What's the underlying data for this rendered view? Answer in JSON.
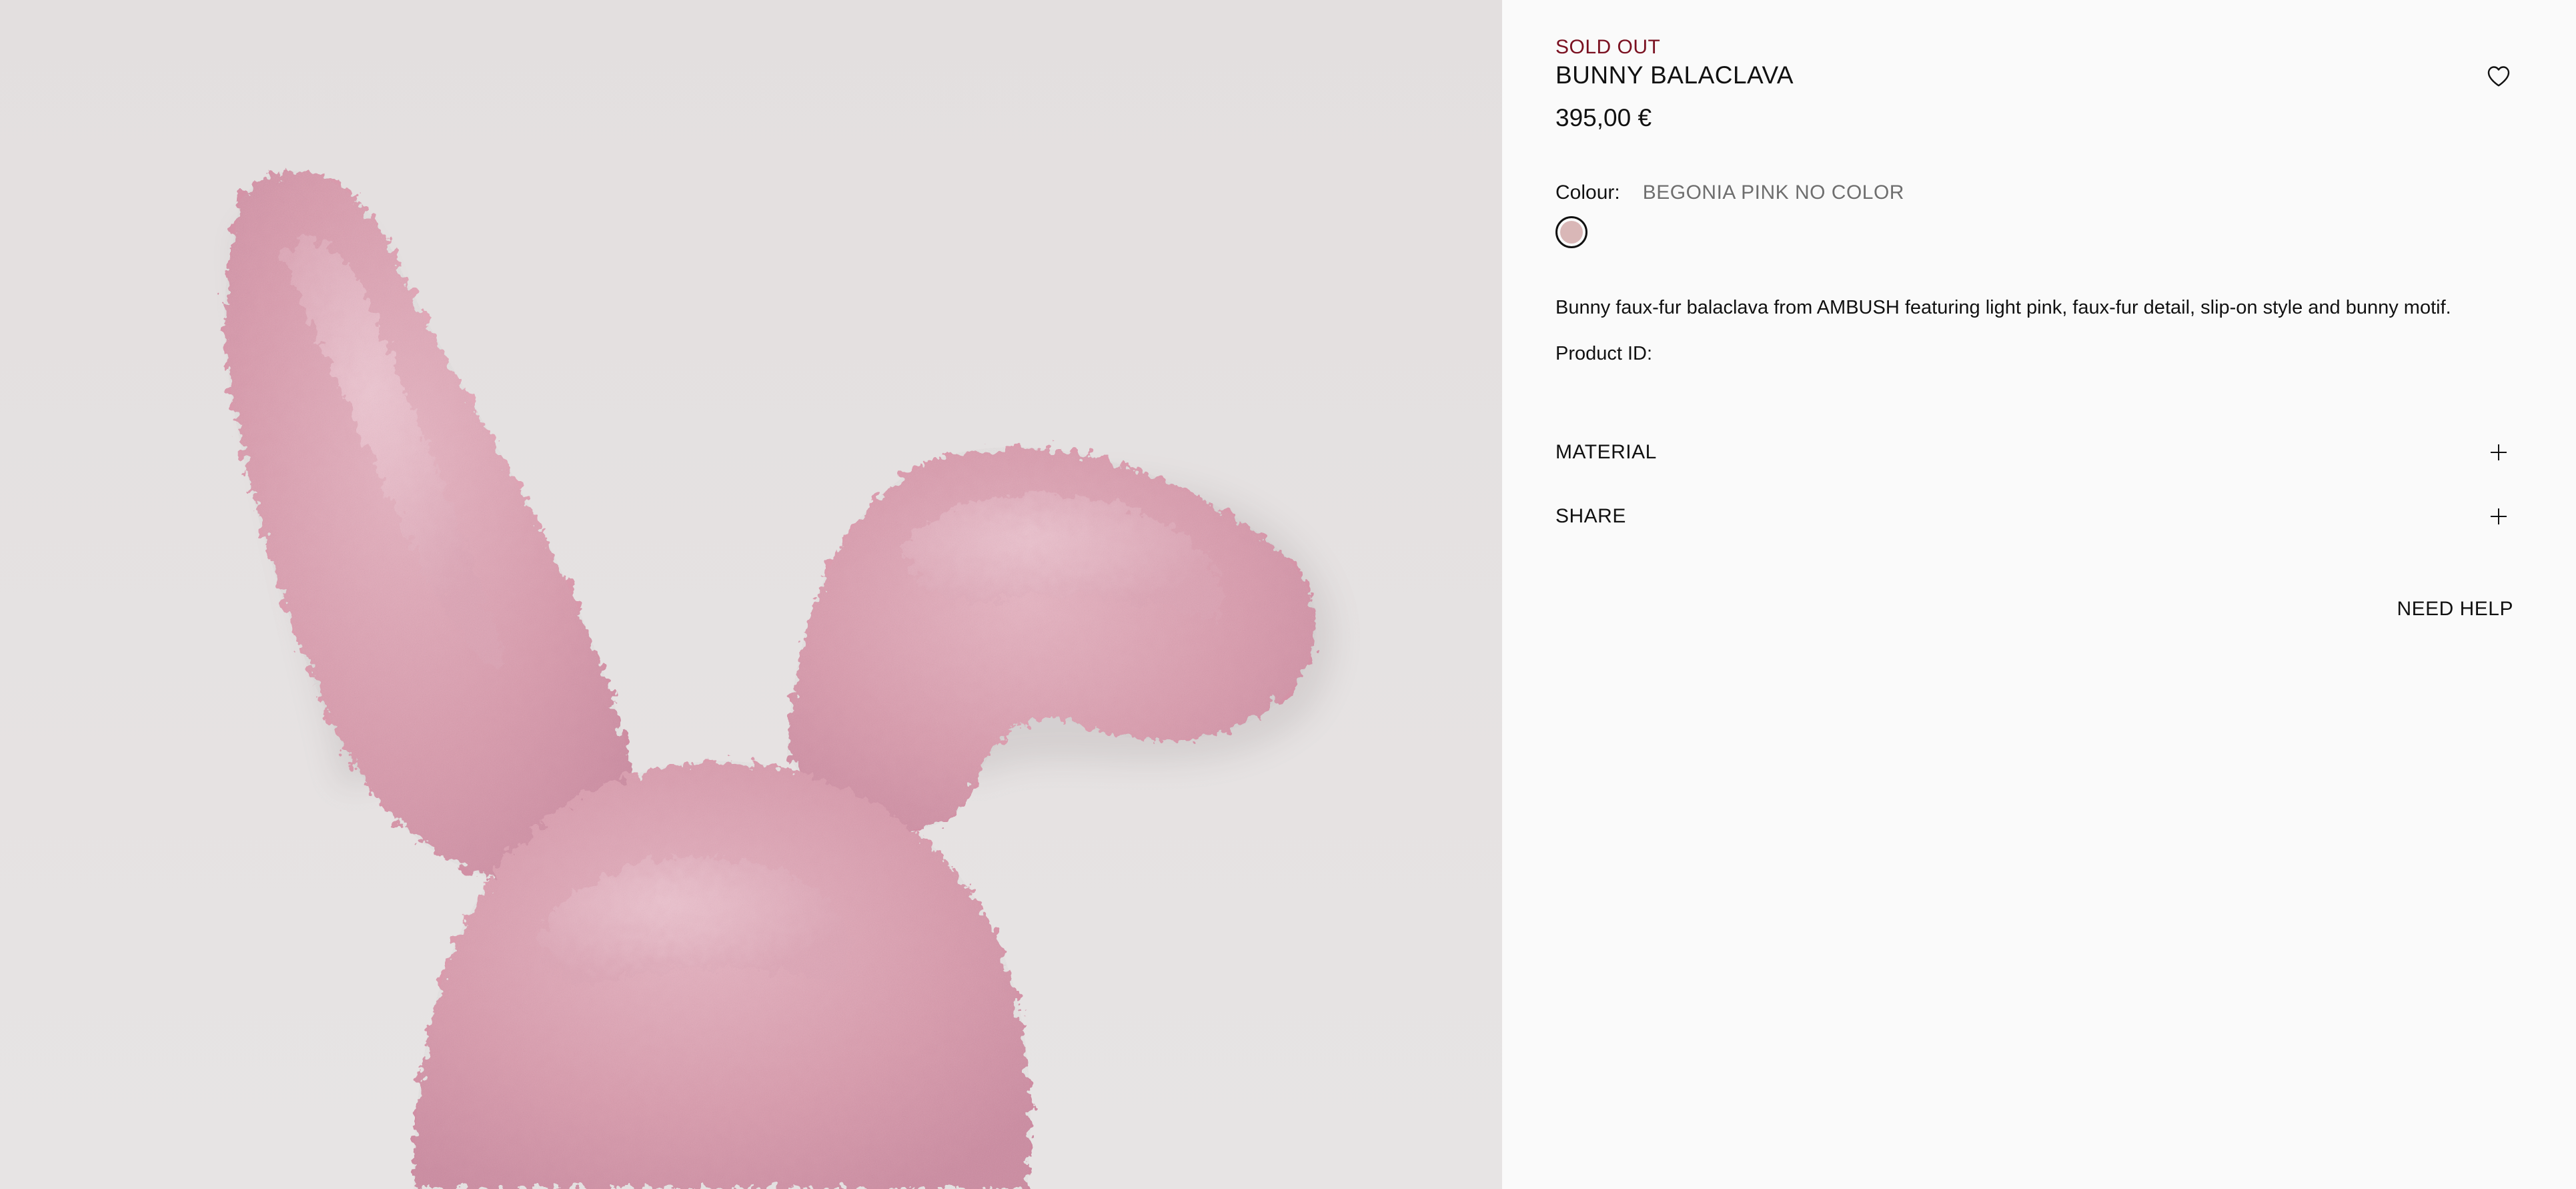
{
  "product_image": {
    "alt_subject": "bunny-balaclava-photo"
  },
  "product": {
    "status": "SOLD OUT",
    "status_color": "#7a1020",
    "name": "BUNNY BALACLAVA",
    "price": "395,00 €",
    "colour_label": "Colour:",
    "colour_value": "BEGONIA PINK NO COLOR",
    "swatch_color": "#d9b7b7",
    "description": "Bunny faux-fur balaclava from AMBUSH featuring light pink, faux-fur detail, slip-on style and bunny motif.",
    "product_id_label": "Product ID:",
    "product_id_value": ""
  },
  "accordions": {
    "material_label": "MATERIAL",
    "share_label": "SHARE"
  },
  "help": {
    "label": "NEED HELP"
  },
  "icons": {
    "wishlist": "heart-icon",
    "expand": "plus-icon"
  }
}
